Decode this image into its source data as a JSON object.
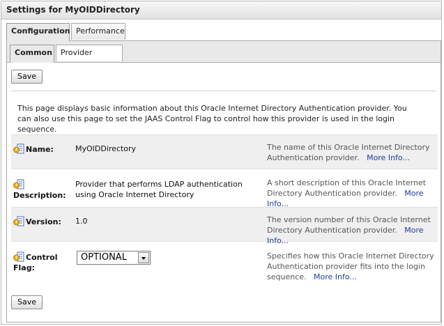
{
  "window": {
    "title": "Settings for MyOIDDirectory"
  },
  "tabs_primary": [
    {
      "label": "Configuration",
      "selected": true
    },
    {
      "label": "Performance",
      "selected": false
    }
  ],
  "tabs_secondary": [
    {
      "label": "Common",
      "selected": true
    },
    {
      "label": "Provider Specific",
      "selected": false
    }
  ],
  "toolbar": {
    "save_label": "Save"
  },
  "intro": "This page displays basic information about this Oracle Internet Directory Authentication provider. You can also use this page to set the JAAS Control Flag to control how this provider is used in the login sequence.",
  "fields": {
    "name": {
      "label": "Name:",
      "value": "MyOIDDirectory",
      "help": "The name of this Oracle Internet Directory Authentication provider.",
      "more": "More Info..."
    },
    "description": {
      "label": "Description:",
      "value": "Provider that performs LDAP authentication using Oracle Internet Directory",
      "help": "A short description of this Oracle Internet Directory Authentication provider.",
      "more": "More Info..."
    },
    "version": {
      "label": "Version:",
      "value": "1.0",
      "help": "The version number of this Oracle Internet Directory Authentication provider.",
      "more": "More Info..."
    },
    "control_flag": {
      "label": "Control Flag:",
      "value": "OPTIONAL",
      "help": "Specifies how this Oracle Internet Directory Authentication provider fits into the login sequence.",
      "more": "More Info..."
    }
  },
  "icons": {
    "field_icon": "info-settings-icon",
    "accent": "#e8a000"
  }
}
